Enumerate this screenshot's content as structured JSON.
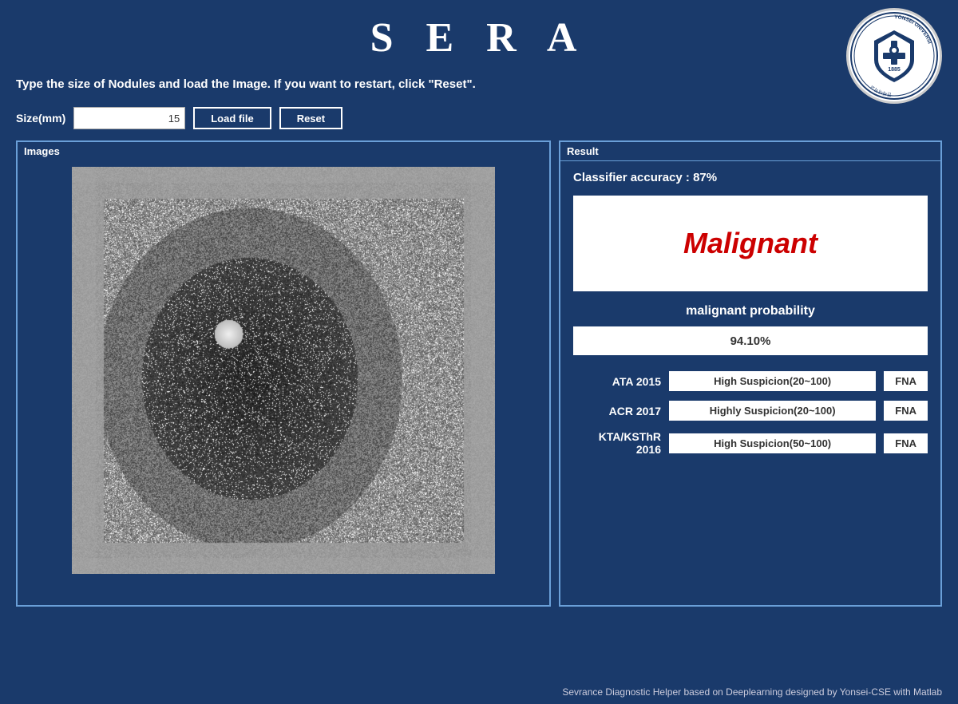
{
  "app": {
    "title": "S E R A"
  },
  "header": {
    "instructions": "Type the size of Nodules and load the Image. If you want to restart, click \"Reset\"."
  },
  "controls": {
    "size_label": "Size(mm)",
    "size_value": "15",
    "load_file_label": "Load file",
    "reset_label": "Reset"
  },
  "images_panel": {
    "label": "Images"
  },
  "result_panel": {
    "label": "Result",
    "classifier_accuracy": "Classifier accuracy : 87%",
    "diagnosis": "Malignant",
    "prob_label": "malignant probability",
    "prob_value": "94.10%",
    "guidelines": [
      {
        "name": "ATA 2015",
        "result": "High Suspicion(20~100)",
        "action": "FNA"
      },
      {
        "name": "ACR 2017",
        "result": "Highly Suspicion(20~100)",
        "action": "FNA"
      },
      {
        "name": "KTA/KSThR 2016",
        "result": "High Suspicion(50~100)",
        "action": "FNA"
      }
    ]
  },
  "footer": {
    "text": "Sevrance Diagnostic Helper based on Deeplearning designed by Yonsei-CSE with Matlab"
  },
  "colors": {
    "bg": "#1a3a6b",
    "panel_border": "#6a9fd8",
    "accent": "#cc0000"
  }
}
